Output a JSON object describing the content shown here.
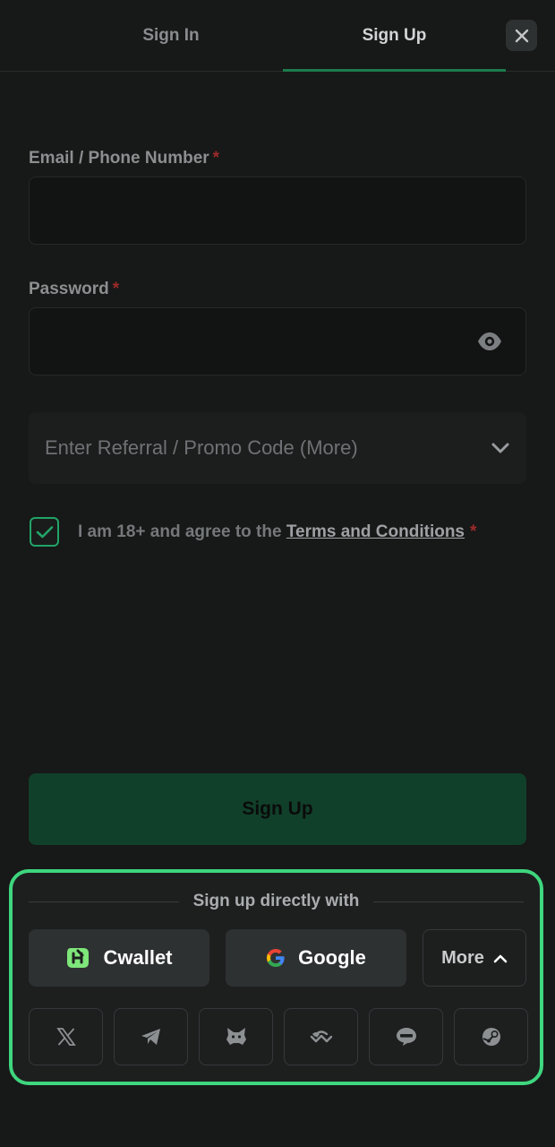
{
  "tabs": {
    "sign_in": "Sign In",
    "sign_up": "Sign Up",
    "active": "sign_up"
  },
  "form": {
    "email_label": "Email / Phone Number",
    "email_value": "",
    "password_label": "Password",
    "password_value": "",
    "required_mark": "*",
    "promo_placeholder": "Enter Referral / Promo Code (More)",
    "agree_text": "I am 18+ and agree to the",
    "terms_link": "Terms and Conditions",
    "agree_checked": true,
    "submit_label": "Sign Up"
  },
  "social": {
    "heading": "Sign up directly with",
    "cwallet_label": "Cwallet",
    "google_label": "Google",
    "more_label": "More",
    "icons": [
      "x-icon",
      "telegram-icon",
      "metamask-icon",
      "walletconnect-icon",
      "line-icon",
      "steam-icon"
    ]
  },
  "colors": {
    "accent": "#3ed67e",
    "primary_button": "#11402a",
    "required": "#9e2a2a",
    "tab_underline": "#1d7a4c"
  }
}
